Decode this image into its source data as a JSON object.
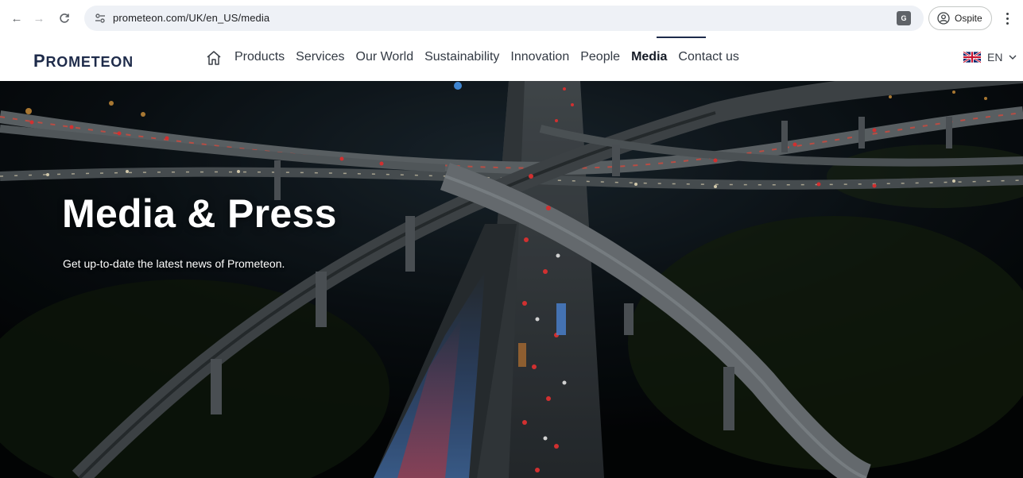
{
  "browser": {
    "url": "prometeon.com/UK/en_US/media",
    "profile_label": "Ospite",
    "icons": {
      "back": "arrow-left-icon",
      "forward": "arrow-right-icon",
      "reload": "reload-icon",
      "site_info": "tune-icon",
      "translate": "translate-icon",
      "profile": "person-circle-icon",
      "menu": "more-vertical-icon"
    }
  },
  "header": {
    "logo_first": "P",
    "logo_rest": "ROMETEON",
    "nav": [
      {
        "label": "Products"
      },
      {
        "label": "Services"
      },
      {
        "label": "Our World"
      },
      {
        "label": "Sustainability"
      },
      {
        "label": "Innovation"
      },
      {
        "label": "People"
      },
      {
        "label": "Media",
        "active": true
      },
      {
        "label": "Contact us"
      }
    ],
    "language": "EN",
    "brand_color": "#1e2b4a"
  },
  "hero": {
    "title": "Media & Press",
    "subtitle": "Get up-to-date the latest news of Prometeon."
  }
}
